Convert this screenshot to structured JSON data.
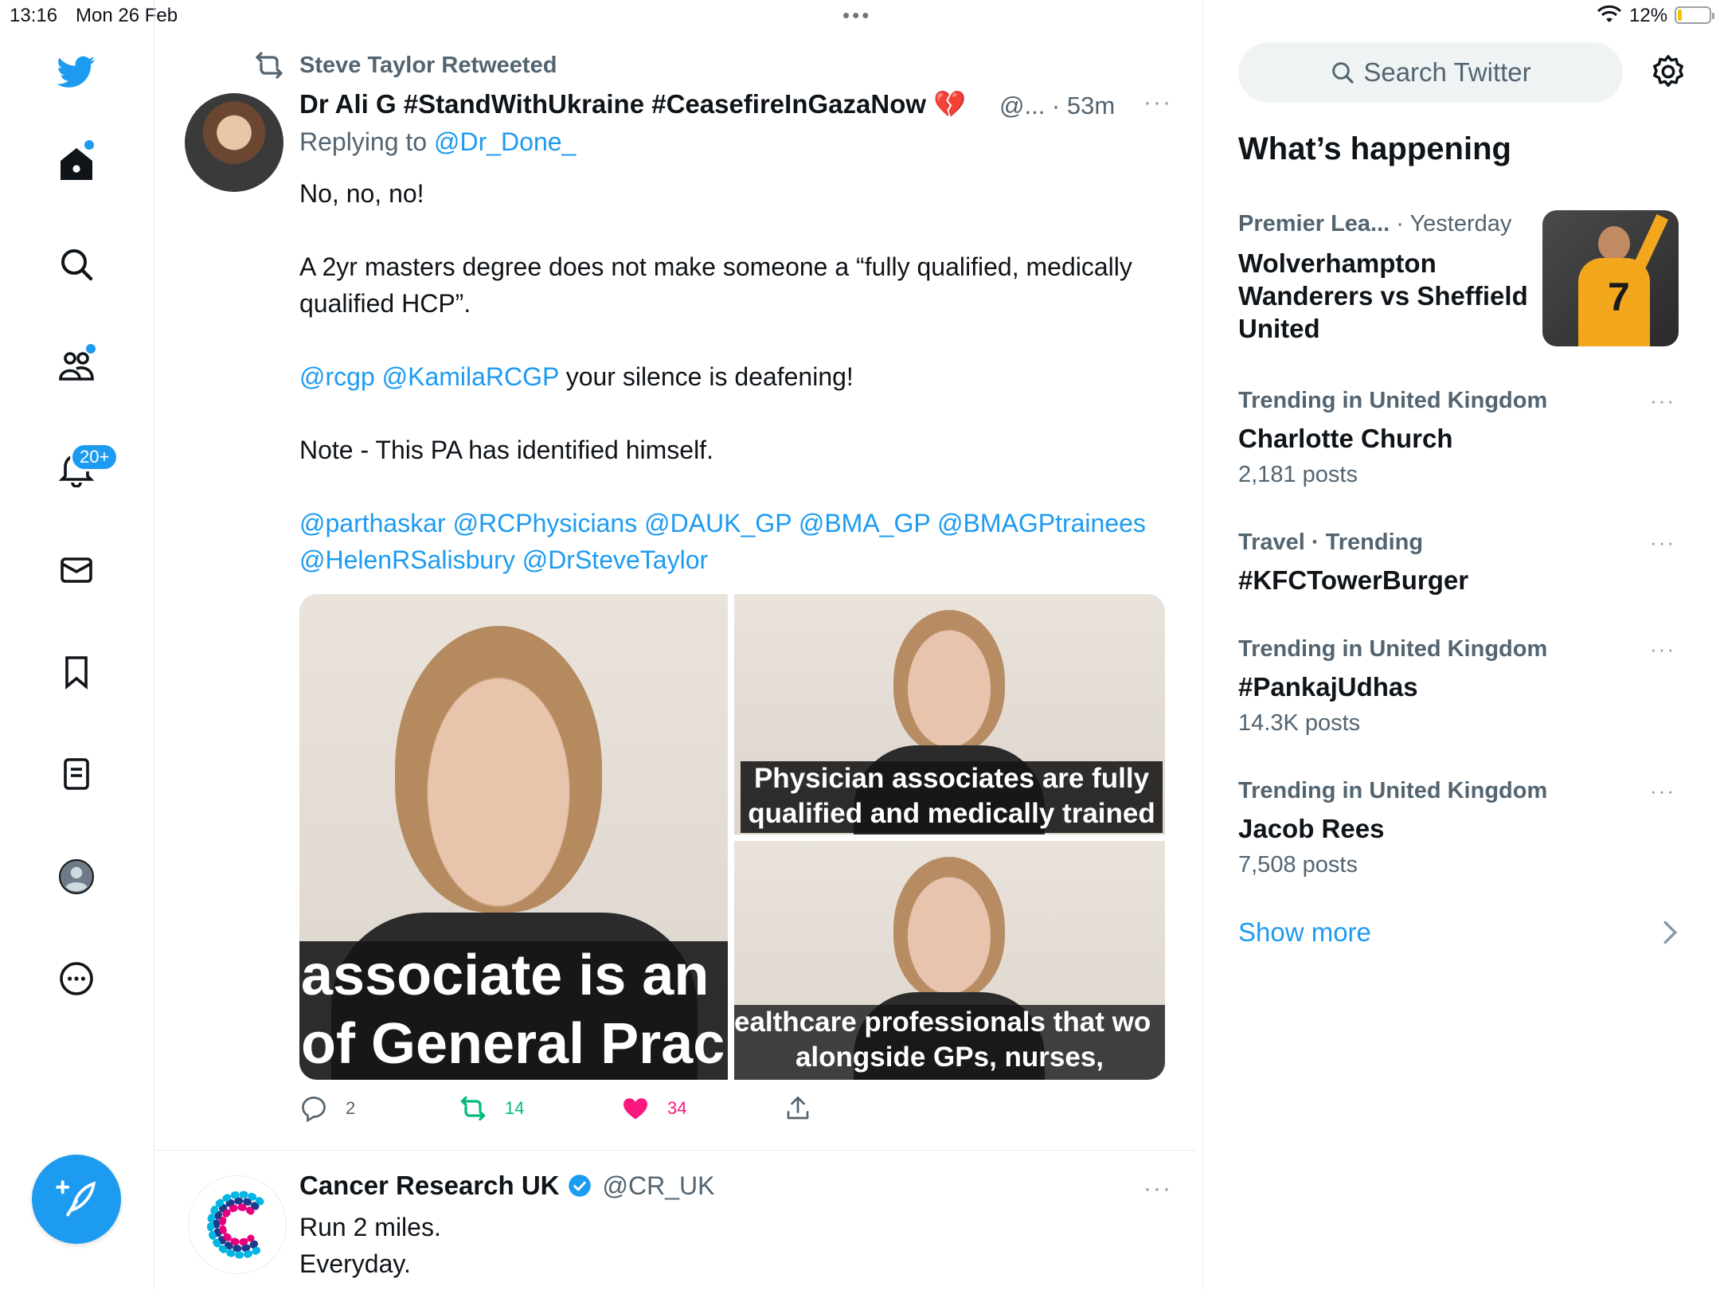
{
  "status_bar": {
    "time": "13:16",
    "date": "Mon 26 Feb",
    "multitask_dots": "•••",
    "battery_percent": "12%",
    "battery_level": 0.12
  },
  "nav": {
    "notifications_badge": "20+"
  },
  "tweet1": {
    "retweeted_by": "Steve Taylor Retweeted",
    "author_name": "Dr Ali G #StandWithUkraine #CeasefireInGazaNow 💔",
    "handle_time": "@... · 53m",
    "more": "···",
    "replying_prefix": "Replying to",
    "replying_handle": "@Dr_Done_",
    "line1": "No, no, no!",
    "line2": "A 2yr masters degree does not make someone a “fully qualified, medically qualified HCP”.",
    "line3_mentions": "@rcgp @KamilaRCGP",
    "line3_text": " your silence is deafening!",
    "line4": "Note - This PA has identified himself.",
    "mentions_line": "@parthaskar @RCPhysicians @DAUK_GP @BMA_GP @BMAGPtrainees @HelenRSalisbury @DrSteveTaylor",
    "media": {
      "caption_large_1": "associate is an",
      "caption_large_2": "of General Prac",
      "caption_tr_1": "Physician associates are fully",
      "caption_tr_2": "qualified and medically trained",
      "caption_br_1": "ealthcare professionals that wo",
      "caption_br_2": "alongside GPs, nurses,"
    },
    "actions": {
      "replies": "2",
      "retweets": "14",
      "likes": "34"
    }
  },
  "tweet2": {
    "author_name": "Cancer Research UK",
    "handle": "@CR_UK",
    "more": "···",
    "line1": "Run 2 miles.",
    "line2": "Everyday."
  },
  "sidebar": {
    "search_placeholder": "Search Twitter",
    "section_title": "What’s happening",
    "trends": [
      {
        "meta": "Premier Lea...",
        "meta_time": " · Yesterday",
        "title": "Wolverhampton Wanderers vs Sheffield United"
      },
      {
        "meta": "Trending in United Kingdom",
        "title": "Charlotte Church",
        "count": "2,181 posts",
        "more": "···"
      },
      {
        "meta": "Travel · Trending",
        "title": "#KFCTowerBurger",
        "more": "···"
      },
      {
        "meta": "Trending in United Kingdom",
        "title": "#PankajUdhas",
        "count": "14.3K posts",
        "more": "···"
      },
      {
        "meta": "Trending in United Kingdom",
        "title": "Jacob Rees",
        "count": "7,508 posts",
        "more": "···"
      }
    ],
    "show_more": "Show more"
  },
  "colors": {
    "accent": "#1d9bf0",
    "retweet": "#00ba7c",
    "like": "#f91880"
  }
}
